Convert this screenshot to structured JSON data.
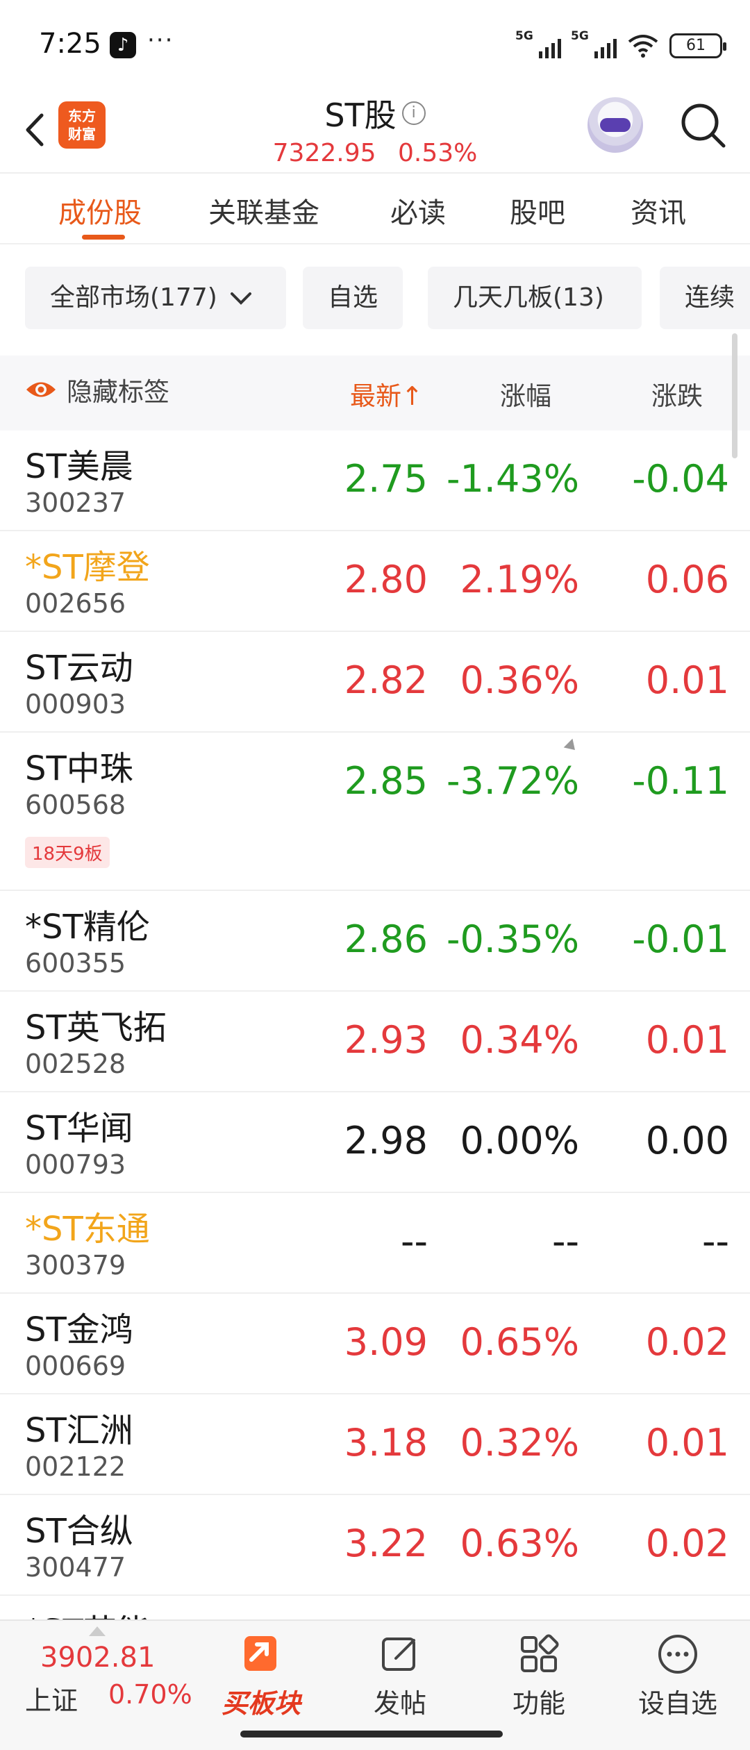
{
  "status_bar": {
    "time": "7:25",
    "app_icon": "tiktok-icon",
    "more_dots": "···",
    "signal_1_label": "5G",
    "signal_2_label": "5G",
    "battery": "61"
  },
  "header": {
    "brand_logo_text_line1": "东方",
    "brand_logo_text_line2": "财富",
    "title": "ST股",
    "info_glyph": "i",
    "index_value": "7322.95",
    "index_change": "0.53%"
  },
  "tabs": [
    {
      "label": "成份股",
      "active": true
    },
    {
      "label": "关联基金",
      "active": false
    },
    {
      "label": "必读",
      "active": false
    },
    {
      "label": "股吧",
      "active": false
    },
    {
      "label": "资讯",
      "active": false
    }
  ],
  "filters": {
    "market": "全部市场(177)",
    "watchlist": "自选",
    "streak": "几天几板(13)",
    "consecutive": "连续"
  },
  "columns": {
    "hide_tags": "隐藏标签",
    "latest": "最新",
    "latest_sort_arrow": "↑",
    "change_pct": "涨幅",
    "change": "涨跌"
  },
  "stocks": [
    {
      "name": "ST美晨",
      "code": "300237",
      "price": "2.75",
      "pct": "-1.43%",
      "chg": "-0.04",
      "dir": "down",
      "highlight": false
    },
    {
      "name": "*ST摩登",
      "code": "002656",
      "price": "2.80",
      "pct": "2.19%",
      "chg": "0.06",
      "dir": "up",
      "highlight": true
    },
    {
      "name": "ST云动",
      "code": "000903",
      "price": "2.82",
      "pct": "0.36%",
      "chg": "0.01",
      "dir": "up",
      "highlight": false
    },
    {
      "name": "ST中珠",
      "code": "600568",
      "price": "2.85",
      "pct": "-3.72%",
      "chg": "-0.11",
      "dir": "down",
      "highlight": false,
      "tag": "18天9板"
    },
    {
      "name": "*ST精伦",
      "code": "600355",
      "price": "2.86",
      "pct": "-0.35%",
      "chg": "-0.01",
      "dir": "down",
      "highlight": false
    },
    {
      "name": "ST英飞拓",
      "code": "002528",
      "price": "2.93",
      "pct": "0.34%",
      "chg": "0.01",
      "dir": "up",
      "highlight": false
    },
    {
      "name": "ST华闻",
      "code": "000793",
      "price": "2.98",
      "pct": "0.00%",
      "chg": "0.00",
      "dir": "flat",
      "highlight": false
    },
    {
      "name": "*ST东通",
      "code": "300379",
      "price": "--",
      "pct": "--",
      "chg": "--",
      "dir": "flat",
      "highlight": true
    },
    {
      "name": "ST金鸿",
      "code": "000669",
      "price": "3.09",
      "pct": "0.65%",
      "chg": "0.02",
      "dir": "up",
      "highlight": false
    },
    {
      "name": "ST汇洲",
      "code": "002122",
      "price": "3.18",
      "pct": "0.32%",
      "chg": "0.01",
      "dir": "up",
      "highlight": false
    },
    {
      "name": "ST合纵",
      "code": "300477",
      "price": "3.22",
      "pct": "0.63%",
      "chg": "0.02",
      "dir": "up",
      "highlight": false
    },
    {
      "name": "*ST节能",
      "code": "",
      "price": "",
      "pct": "",
      "chg": "",
      "dir": "flat",
      "highlight": false
    }
  ],
  "bottom_bar": {
    "index_value": "3902.81",
    "index_name": "上证",
    "index_pct": "0.70%",
    "buy_sector": "买板块",
    "post": "发帖",
    "functions": "功能",
    "add_watchlist": "设自选"
  },
  "colors": {
    "accent": "#e8591a",
    "up": "#e4393c",
    "down": "#1f9b1f",
    "highlight_name": "#f2a51b"
  }
}
